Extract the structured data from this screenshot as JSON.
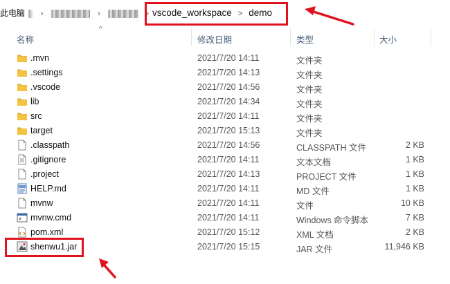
{
  "breadcrumb": {
    "root_label": "此电脑",
    "path": [
      "vscode_workspace",
      "demo"
    ]
  },
  "columns": {
    "name": "名称",
    "date": "修改日期",
    "type": "类型",
    "size": "大小"
  },
  "files": [
    {
      "name": ".mvn",
      "date": "2021/7/20 14:11",
      "type": "文件夹",
      "size": "",
      "icon": "folder-icon"
    },
    {
      "name": ".settings",
      "date": "2021/7/20 14:13",
      "type": "文件夹",
      "size": "",
      "icon": "folder-icon"
    },
    {
      "name": ".vscode",
      "date": "2021/7/20 14:56",
      "type": "文件夹",
      "size": "",
      "icon": "folder-icon"
    },
    {
      "name": "lib",
      "date": "2021/7/20 14:34",
      "type": "文件夹",
      "size": "",
      "icon": "folder-icon"
    },
    {
      "name": "src",
      "date": "2021/7/20 14:11",
      "type": "文件夹",
      "size": "",
      "icon": "folder-icon"
    },
    {
      "name": "target",
      "date": "2021/7/20 15:13",
      "type": "文件夹",
      "size": "",
      "icon": "folder-icon"
    },
    {
      "name": ".classpath",
      "date": "2021/7/20 14:56",
      "type": "CLASSPATH 文件",
      "size": "2 KB",
      "icon": "file-icon"
    },
    {
      "name": ".gitignore",
      "date": "2021/7/20 14:11",
      "type": "文本文档",
      "size": "1 KB",
      "icon": "text-file-icon"
    },
    {
      "name": ".project",
      "date": "2021/7/20 14:13",
      "type": "PROJECT 文件",
      "size": "1 KB",
      "icon": "file-icon"
    },
    {
      "name": "HELP.md",
      "date": "2021/7/20 14:11",
      "type": "MD 文件",
      "size": "1 KB",
      "icon": "md-file-icon"
    },
    {
      "name": "mvnw",
      "date": "2021/7/20 14:11",
      "type": "文件",
      "size": "10 KB",
      "icon": "file-icon"
    },
    {
      "name": "mvnw.cmd",
      "date": "2021/7/20 14:11",
      "type": "Windows 命令脚本",
      "size": "7 KB",
      "icon": "cmd-file-icon"
    },
    {
      "name": "pom.xml",
      "date": "2021/7/20 15:12",
      "type": "XML 文档",
      "size": "2 KB",
      "icon": "xml-file-icon"
    },
    {
      "name": "shenwu1.jar",
      "date": "2021/7/20 15:15",
      "type": "JAR 文件",
      "size": "11,946 KB",
      "icon": "jar-file-icon"
    }
  ],
  "colors": {
    "highlight": "#e0121d",
    "folder": "#f5c342",
    "header_text": "#4c607a"
  }
}
